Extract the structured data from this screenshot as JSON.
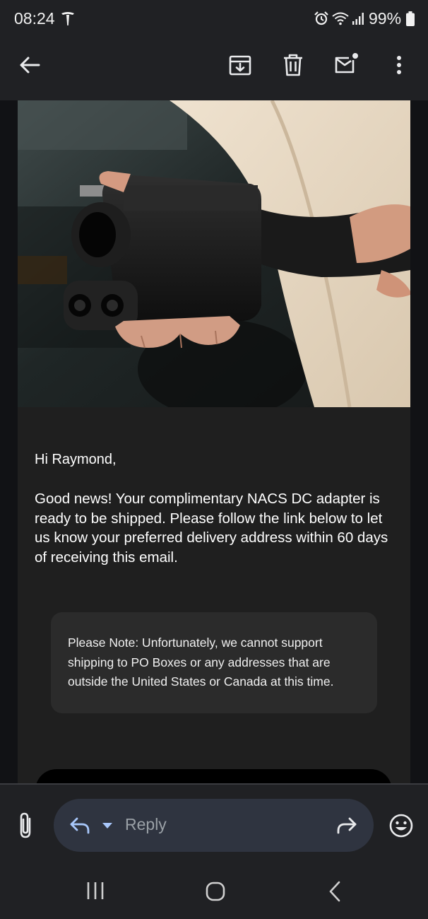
{
  "status_bar": {
    "time": "08:24",
    "battery": "99%",
    "icons": [
      "tesla-icon",
      "alarm-icon",
      "wifi-icon",
      "signal-icon",
      "battery-icon"
    ]
  },
  "toolbar": {
    "icons": [
      "back-arrow-icon",
      "archive-icon",
      "delete-icon",
      "mark-unread-icon",
      "more-options-icon"
    ]
  },
  "email": {
    "hero_image": "photo-of-hand-holding-nacs-dc-adapter",
    "greeting": "Hi Raymond,",
    "body": "Good news! Your complimentary NACS DC adapter is ready to be shipped. Please follow the link below to let us know your preferred delivery address within 60 days of receiving this email.",
    "note": "Please Note: Unfortunately, we cannot support shipping to PO Boxes or any addresses that are outside the United States or Canada at this time."
  },
  "reply_bar": {
    "reply_label": "Reply",
    "icons": [
      "attach-icon",
      "reply-arrow-icon",
      "caret-down-icon",
      "forward-icon",
      "emoji-icon"
    ]
  },
  "nav": {
    "icons": [
      "recent-apps-icon",
      "home-icon",
      "nav-back-icon"
    ]
  },
  "colors": {
    "background": "#0f1115",
    "bars": "#202124",
    "email_card": "#1f1f1f",
    "note_box": "#2b2b2b",
    "reply_pill": "#2f3440",
    "text": "#ffffff",
    "placeholder": "#9aa0a6"
  }
}
